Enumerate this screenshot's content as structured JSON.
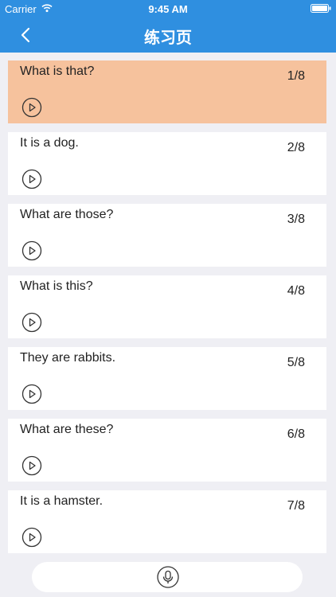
{
  "status": {
    "carrier": "Carrier",
    "time": "9:45 AM"
  },
  "nav": {
    "title": "练习页"
  },
  "colors": {
    "header": "#2f8fe0",
    "active_card": "#f6c29d",
    "background": "#efeff4"
  },
  "items": [
    {
      "text": "What is that?",
      "counter": "1/8",
      "active": true
    },
    {
      "text": "It is a dog.",
      "counter": "2/8"
    },
    {
      "text": "What are those?",
      "counter": "3/8"
    },
    {
      "text": "What is this?",
      "counter": "4/8"
    },
    {
      "text": "They are rabbits.",
      "counter": "5/8"
    },
    {
      "text": "What are these?",
      "counter": "6/8"
    },
    {
      "text": "It is a hamster.",
      "counter": "7/8"
    }
  ],
  "icons": {
    "back": "chevron-left-icon",
    "play": "play-circle-icon",
    "mic": "microphone-icon",
    "wifi": "wifi-icon",
    "battery": "battery-icon"
  }
}
